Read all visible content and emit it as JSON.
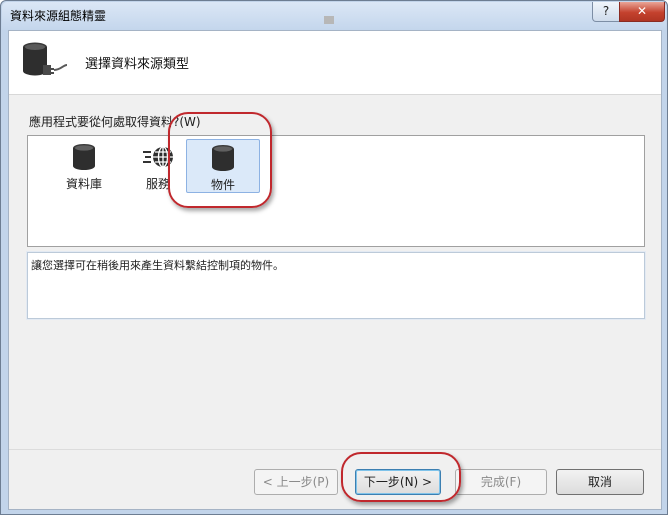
{
  "window": {
    "title": "資料來源組態精靈",
    "help_label": "?",
    "close_label": "✕"
  },
  "header": {
    "title": "選擇資料來源類型",
    "icon": "database-plug-icon"
  },
  "question": "應用程式要從何處取得資料?(W)",
  "source_types": [
    {
      "label": "資料庫",
      "icon": "database-icon",
      "selected": false
    },
    {
      "label": "服務",
      "icon": "service-globe-icon",
      "selected": false
    },
    {
      "label": "物件",
      "icon": "object-database-icon",
      "selected": true
    }
  ],
  "description": "讓您選擇可在稍後用來產生資料繫結控制項的物件。",
  "buttons": {
    "previous": "< 上一步(P)",
    "next": "下一步(N) >",
    "finish": "完成(F)",
    "cancel": "取消"
  },
  "colors": {
    "annotation": "#c0282d",
    "selected_tile": "#dbe9f9"
  }
}
